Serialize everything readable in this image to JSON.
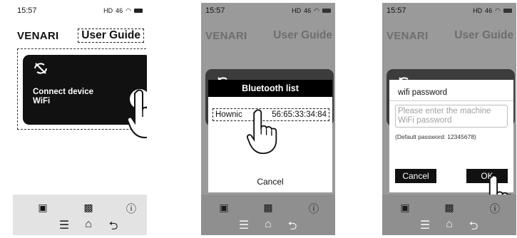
{
  "status": {
    "time": "15:57",
    "signal_text": "46",
    "hd_text": "HD"
  },
  "app": {
    "brand": "VENARI",
    "guide_link": "User Guide"
  },
  "card": {
    "line1": "Connect device",
    "line2": "WiFi",
    "arrow_glyph": "→"
  },
  "bluetooth": {
    "title": "Bluetooth list",
    "device_name": "Hownic",
    "device_mac": "56:65:33:34:84",
    "cancel_label": "Cancel"
  },
  "wifi": {
    "title": "wifi password",
    "placeholder_line1": "Please enter the machine",
    "placeholder_line2": "WiFi password",
    "default_hint": "(Default password: 12345678)",
    "cancel_label": "Cancel",
    "ok_label": "OK"
  },
  "nav": {
    "device_icon": "speaker-icon",
    "gallery_icon": "gallery-icon",
    "info_icon": "info-icon",
    "menu_glyph": "☰",
    "home_glyph": "⌂",
    "back_glyph": "⮌"
  },
  "colors": {
    "dim_overlay": "#9a9a9a",
    "card_bg": "#111111",
    "nav_bg": "#e3e3e3"
  }
}
